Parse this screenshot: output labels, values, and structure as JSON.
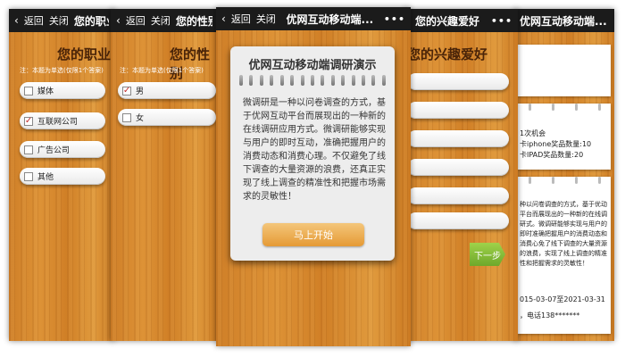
{
  "screen1": {
    "back": "返回",
    "close": "关闭",
    "title": "您的职业",
    "heading": "您的职业",
    "note": "注：本题为单选(仅限1个答案)",
    "options": [
      {
        "label": "媒体",
        "checked": false
      },
      {
        "label": "互联网公司",
        "checked": true
      },
      {
        "label": "广告公司",
        "checked": false
      },
      {
        "label": "其他",
        "checked": false
      }
    ]
  },
  "screen2": {
    "back": "返回",
    "close": "关闭",
    "title": "您的性别",
    "heading": "您的性别",
    "note": "注：本题为单选(仅限1个答案)",
    "options": [
      {
        "label": "男",
        "checked": true
      },
      {
        "label": "女",
        "checked": false
      }
    ]
  },
  "screen3": {
    "back": "返回",
    "close": "关闭",
    "title": "优网互动移动端...",
    "more": "•••",
    "modal": {
      "title": "优网互动移动端调研演示",
      "text": "微调研是一种以问卷调查的方式，基于优网互动平台而展现出的一种新的在线调研应用方式。微调研能够实现与用户的即时互动，准确把握用户的消费动态和消费心理。不仅避免了线下调查的大量资源的浪费，还真正实现了线上调查的精准性和把握市场需求的灵敏性！",
      "button": "马上开始"
    }
  },
  "screen4": {
    "title": "您的兴趣爱好",
    "more": "•••",
    "heading": "您的兴趣爱好",
    "next": "下一步"
  },
  "screen5": {
    "title": "优网互动移动端...",
    "card2": {
      "lines": [
        "1次机会",
        "卡iphone奖品数量:10",
        "卡IPAD奖品数量:20"
      ]
    },
    "card3": {
      "text": "种以问卷调查的方式，基于优动平台而展现出的一种新的在线调研式。微调研能够实现与用户的即时准确把握用户的消费动态和消费心免了线下调查的大量资源的浪费，实现了线上调查的精准性和把握需求的灵敏性！",
      "date": "015-03-07至2021-03-31",
      "phone": "，电话138*******"
    }
  },
  "colors": {
    "wood": "#d88a2f",
    "topbar": "#1b1b1b",
    "heading": "#4a2408",
    "check": "#c22b2b",
    "start_button": "#e59a35",
    "next_button": "#7eb634"
  }
}
